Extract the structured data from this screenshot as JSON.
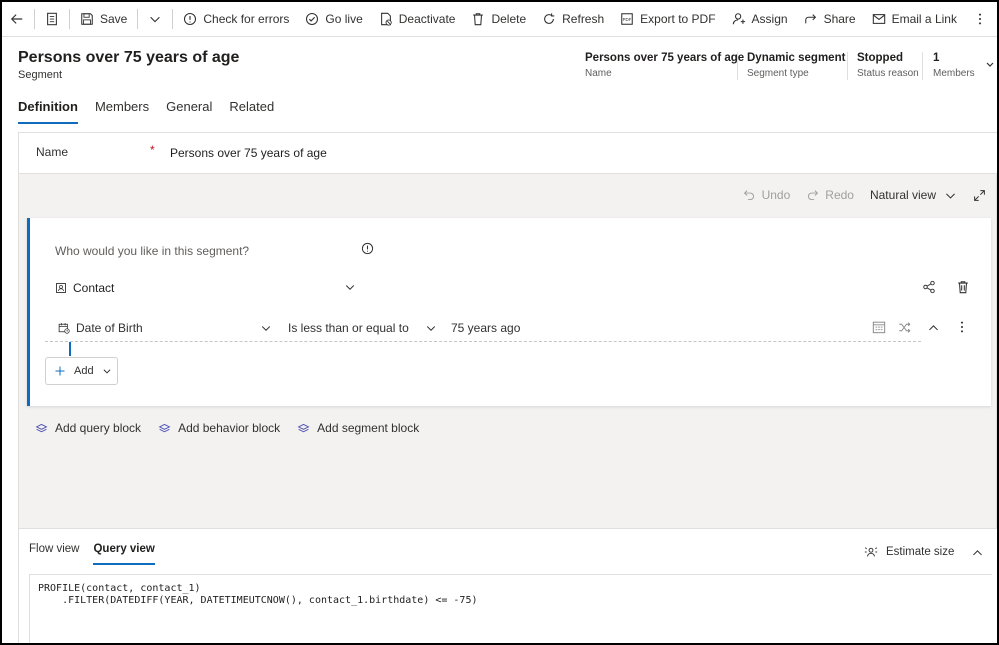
{
  "commandbar": {
    "items": [
      {
        "label": "Save",
        "icon": "save-icon"
      },
      {
        "label": "Check for errors",
        "icon": "check-errors-icon"
      },
      {
        "label": "Go live",
        "icon": "go-live-icon"
      },
      {
        "label": "Deactivate",
        "icon": "deactivate-icon"
      },
      {
        "label": "Delete",
        "icon": "delete-icon"
      },
      {
        "label": "Refresh",
        "icon": "refresh-icon"
      },
      {
        "label": "Export to PDF",
        "icon": "pdf-icon"
      },
      {
        "label": "Assign",
        "icon": "assign-icon"
      },
      {
        "label": "Share",
        "icon": "share-icon"
      },
      {
        "label": "Email a Link",
        "icon": "email-icon"
      }
    ]
  },
  "header": {
    "title": "Persons over 75 years of age",
    "subtitle": "Segment",
    "fields": [
      {
        "value": "Persons over 75 years of age",
        "label": "Name"
      },
      {
        "value": "Dynamic segment",
        "label": "Segment type"
      },
      {
        "value": "Stopped",
        "label": "Status reason"
      },
      {
        "value": "1",
        "label": "Members"
      }
    ]
  },
  "tabs": [
    {
      "label": "Definition",
      "active": true
    },
    {
      "label": "Members",
      "active": false
    },
    {
      "label": "General",
      "active": false
    },
    {
      "label": "Related",
      "active": false
    }
  ],
  "form": {
    "name_label": "Name",
    "required_marker": "*",
    "name_value": "Persons over 75 years of age"
  },
  "designer": {
    "undo": "Undo",
    "redo": "Redo",
    "view_mode": "Natural view",
    "question": "Who would you like in this segment?",
    "entity": "Contact",
    "condition": {
      "attribute": "Date of Birth",
      "operator": "Is less than or equal to",
      "value": "75 years ago"
    },
    "add_label": "Add",
    "blocks": [
      {
        "label": "Add query block"
      },
      {
        "label": "Add behavior block"
      },
      {
        "label": "Add segment block"
      }
    ]
  },
  "bottom": {
    "tabs": [
      {
        "label": "Flow view",
        "active": false
      },
      {
        "label": "Query view",
        "active": true
      }
    ],
    "estimate_label": "Estimate size",
    "query_lines": [
      "PROFILE(contact, contact_1)",
      "    .FILTER(DATEDIFF(YEAR, DATETIMEUTCNOW(), contact_1.birthdate) <= -75)"
    ]
  },
  "colors": {
    "accent": "#0f6cbd",
    "required": "#c50f1f"
  }
}
